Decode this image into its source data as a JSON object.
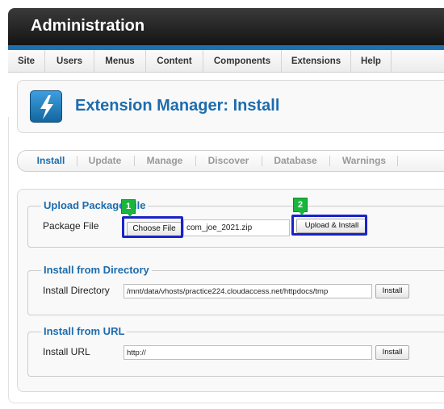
{
  "header": {
    "title": "Administration"
  },
  "menu": {
    "items": [
      "Site",
      "Users",
      "Menus",
      "Content",
      "Components",
      "Extensions",
      "Help"
    ]
  },
  "page": {
    "title": "Extension Manager: Install"
  },
  "tabs": {
    "items": [
      "Install",
      "Update",
      "Manage",
      "Discover",
      "Database",
      "Warnings"
    ],
    "active": "Install"
  },
  "upload_package": {
    "legend": "Upload Package File",
    "field_label": "Package File",
    "choose_button": "Choose File",
    "file_name": "com_joe_2021.zip",
    "submit_button": "Upload & Install"
  },
  "install_directory": {
    "legend": "Install from Directory",
    "field_label": "Install Directory",
    "value": "/mnt/data/vhosts/practice224.cloudaccess.net/httpdocs/tmp",
    "button": "Install"
  },
  "install_url": {
    "legend": "Install from URL",
    "field_label": "Install URL",
    "value": "http://",
    "button": "Install"
  },
  "annotations": {
    "badge_1": "1",
    "badge_2": "2",
    "highlight_color": "#1a22c9",
    "badge_color": "#19b53c"
  },
  "colors": {
    "accent_blue": "#1c6cae",
    "header_dark": "#1e1e1e",
    "header_stripe": "#1e6fb0"
  }
}
